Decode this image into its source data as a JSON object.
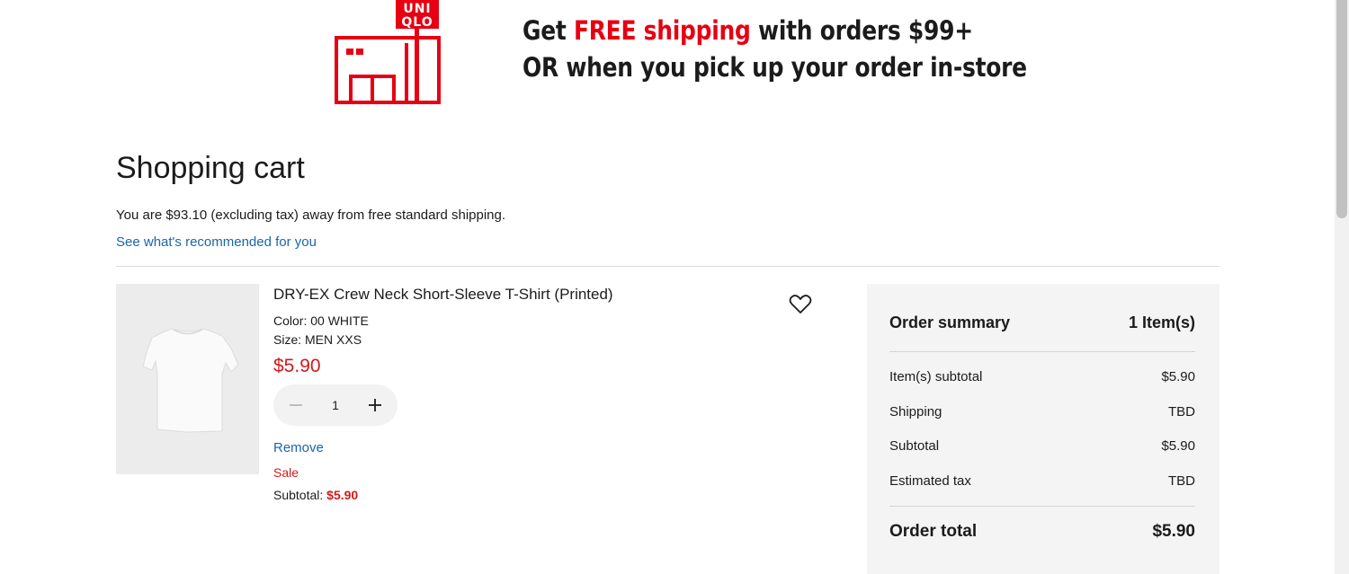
{
  "banner": {
    "logo_line1": "UNI",
    "logo_line2": "QLO",
    "line1_pre": "Get ",
    "line1_highlight": "FREE shipping",
    "line1_post": " with orders $99+",
    "line2": "OR when you pick up your order in-store",
    "accent_color": "#e60012"
  },
  "cart": {
    "title": "Shopping cart",
    "free_shipping_message": "You are $93.10 (excluding tax) away from free standard shipping.",
    "recommend_link": "See what's recommended for you"
  },
  "item": {
    "name": "DRY-EX Crew Neck Short-Sleeve T-Shirt (Printed)",
    "color": "Color: 00 WHITE",
    "size": "Size: MEN XXS",
    "price": "$5.90",
    "quantity": "1",
    "remove_label": "Remove",
    "sale_label": "Sale",
    "subtotal_label": "Subtotal: ",
    "subtotal_value": "$5.90",
    "wishlist_icon": "heart-icon",
    "minus_icon": "minus-icon",
    "plus_icon": "plus-icon"
  },
  "summary": {
    "title": "Order summary",
    "count": "1 Item(s)",
    "rows": [
      {
        "label": "Item(s) subtotal",
        "value": "$5.90"
      },
      {
        "label": "Shipping",
        "value": "TBD"
      },
      {
        "label": "Subtotal",
        "value": "$5.90"
      },
      {
        "label": "Estimated tax",
        "value": "TBD"
      }
    ],
    "total_label": "Order total",
    "total_value": "$5.90"
  },
  "colors": {
    "link": "#1a66a8",
    "sale_red": "#d11a1a",
    "summary_bg": "#f4f4f4"
  }
}
